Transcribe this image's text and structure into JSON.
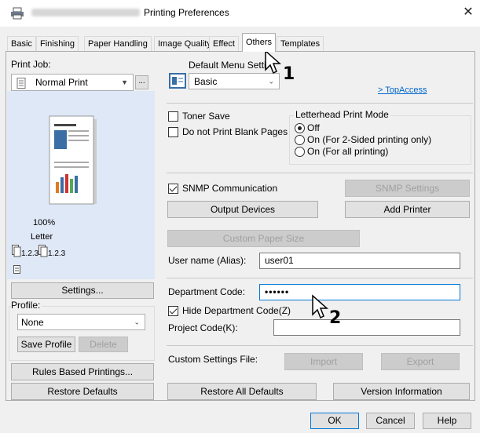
{
  "window": {
    "title": "Printing Preferences",
    "close_glyph": "✕",
    "icon": "printer-icon"
  },
  "tabs": [
    {
      "label": "Basic"
    },
    {
      "label": "Finishing"
    },
    {
      "label": "Paper Handling"
    },
    {
      "label": "Image Quality"
    },
    {
      "label": "Effect"
    },
    {
      "label": "Others"
    },
    {
      "label": "Templates"
    }
  ],
  "left": {
    "print_job_label": "Print Job:",
    "print_job_value": "Normal Print",
    "ellipsis": "...",
    "preview": {
      "zoom": "100%",
      "paper": "Letter",
      "collate_a": "1.2.3",
      "collate_b": "1.2.3"
    },
    "settings_button": "Settings...",
    "profile_label": "Profile:",
    "profile_value": "None",
    "save_profile": "Save Profile",
    "delete": "Delete",
    "rules_button": "Rules Based Printings...",
    "restore_defaults": "Restore Defaults"
  },
  "right": {
    "default_menu_label": "Default Menu Setti",
    "default_menu_value": "Basic",
    "topaccess_link": "> TopAccess",
    "toner_save": "Toner Save",
    "blank_pages": "Do not Print Blank Pages",
    "letterhead_label": "Letterhead Print Mode",
    "letterhead_options": [
      {
        "label": "Off",
        "checked": true
      },
      {
        "label": "On (For 2-Sided printing only)",
        "checked": false
      },
      {
        "label": "On (For all printing)",
        "checked": false
      }
    ],
    "snmp": "SNMP Communication",
    "snmp_settings": "SNMP Settings",
    "output_devices": "Output Devices",
    "add_printer": "Add Printer",
    "custom_paper": "Custom Paper Size",
    "user_name_label": "User name (Alias):",
    "user_name_value": "user01",
    "dept_code_label": "Department Code:",
    "dept_code_value": "••••••",
    "hide_dept_code": "Hide Department Code(Z)",
    "project_code_label": "Project Code(K):",
    "project_code_value": "",
    "custom_settings_label": "Custom Settings File:",
    "import": "Import",
    "export": "Export",
    "restore_all": "Restore All Defaults",
    "version_info": "Version Information"
  },
  "footer": {
    "ok": "OK",
    "cancel": "Cancel",
    "help": "Help"
  },
  "callouts": {
    "one": "1",
    "two": "2"
  }
}
